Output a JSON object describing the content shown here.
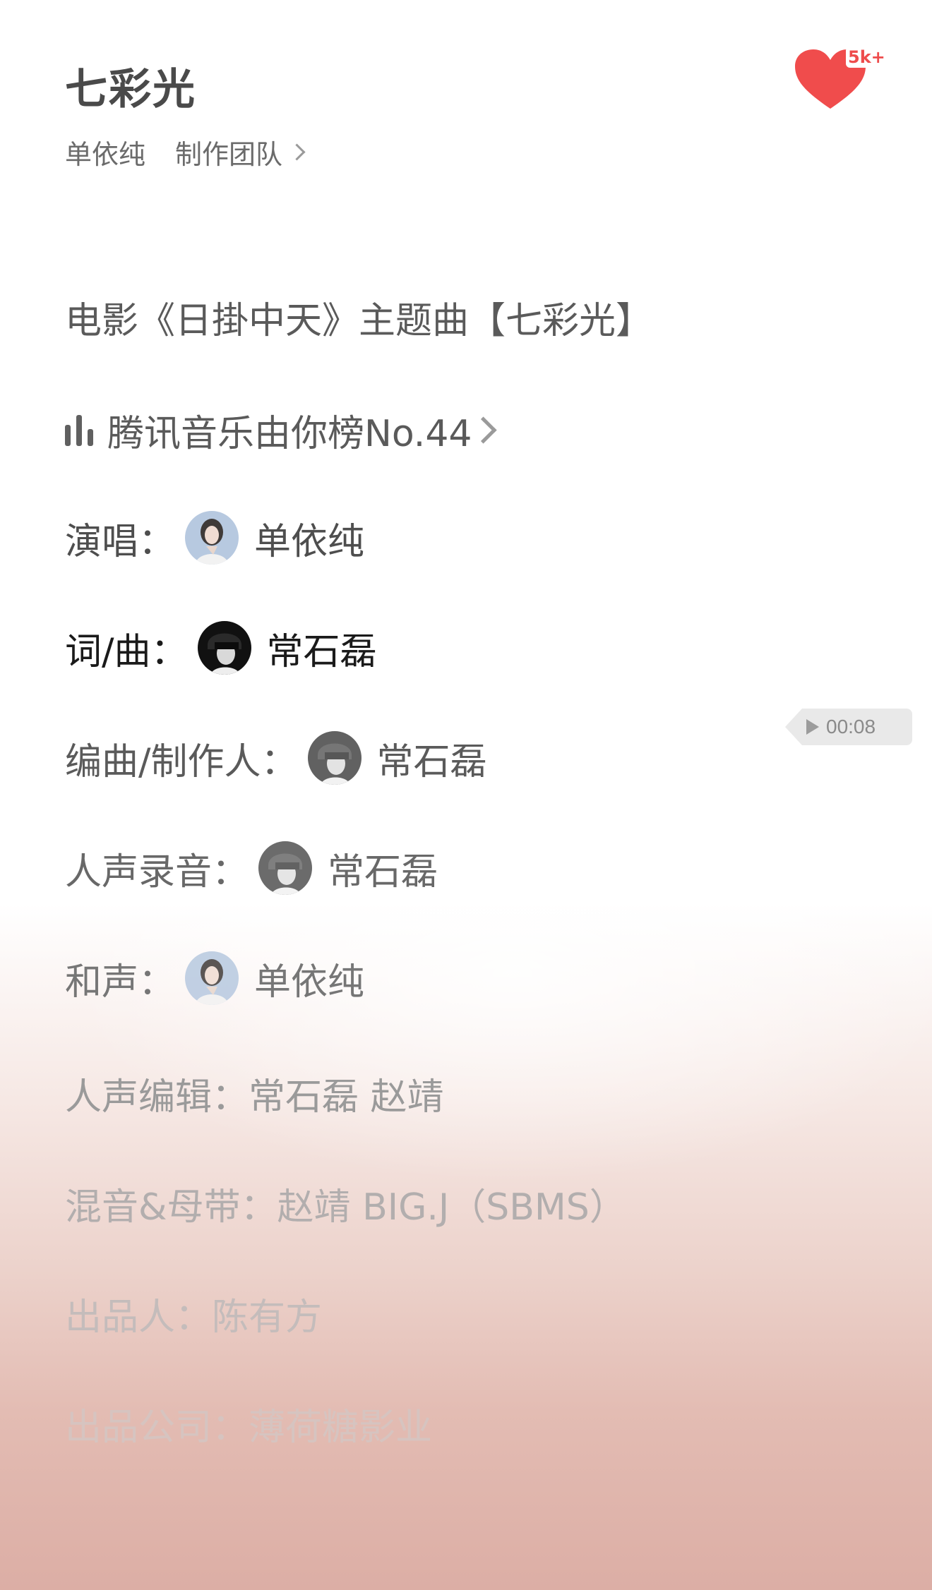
{
  "song": {
    "title": "七彩光",
    "artist": "单依纯",
    "team_label": "制作团队"
  },
  "favorite": {
    "count": "5k+",
    "color": "#f04c4c"
  },
  "credits": {
    "theme": "电影《日掛中天》主题曲【七彩光】",
    "chart_rank": "腾讯音乐由你榜No.44",
    "vocal": {
      "label": "演唱：",
      "name": "单依纯"
    },
    "lyrics_music": {
      "label": "词/曲：",
      "name": "常石磊"
    },
    "arranger": {
      "label": "编曲/制作人：",
      "name": "常石磊"
    },
    "vocal_recording": {
      "label": "人声录音：",
      "name": "常石磊"
    },
    "harmony": {
      "label": "和声：",
      "name": "单依纯"
    },
    "vocal_editing": "人声编辑：常石磊   赵靖",
    "mixing": "混音&母带：赵靖 BIG.J（SBMS）",
    "producer": "出品人：陈有方",
    "company": "出品公司：薄荷糖影业"
  },
  "player": {
    "time": "00:08"
  },
  "icons": {
    "heart": "heart-icon",
    "chart": "chart-bars-icon",
    "chevron": "chevron-right-icon",
    "play": "play-icon"
  }
}
